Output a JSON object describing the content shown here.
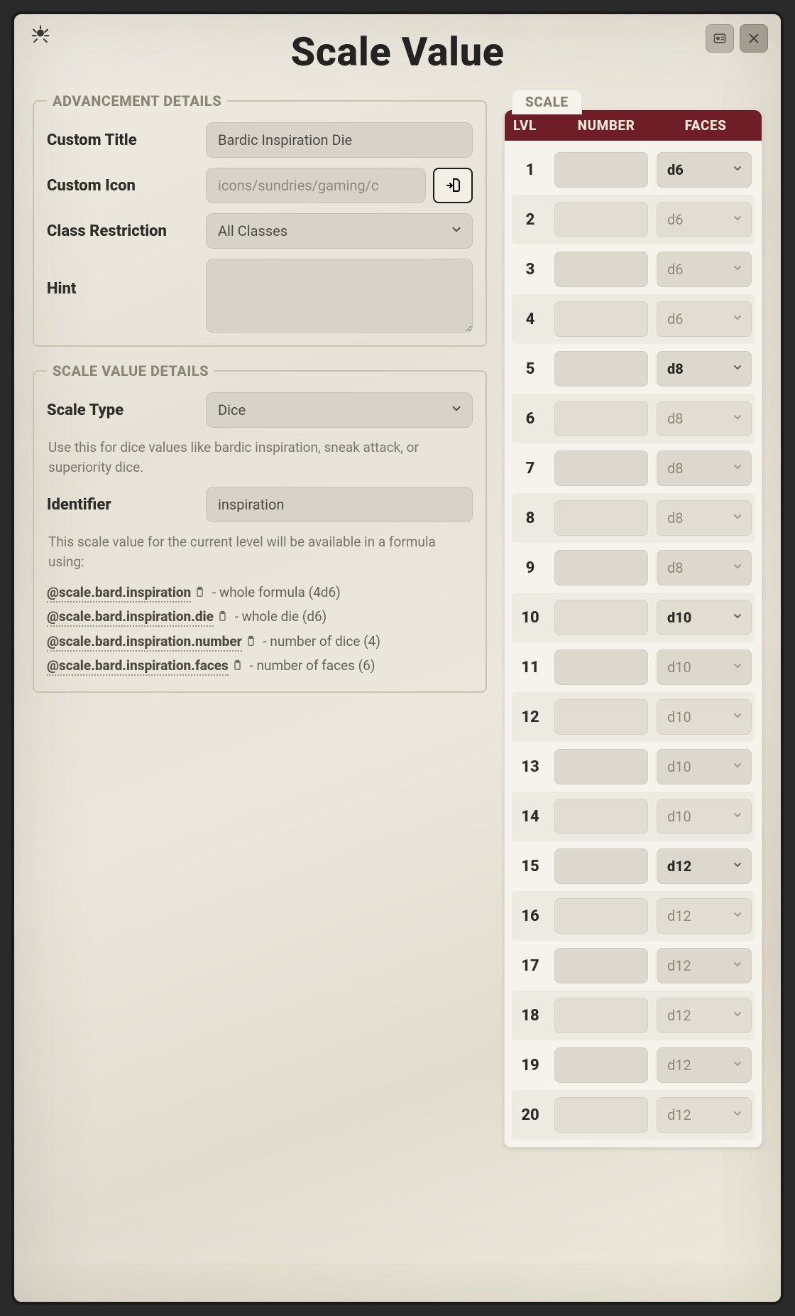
{
  "window": {
    "title": "Scale Value"
  },
  "advancement": {
    "legend": "ADVANCEMENT DETAILS",
    "title_label": "Custom Title",
    "title_value": "Bardic Inspiration Die",
    "icon_label": "Custom Icon",
    "icon_placeholder": "icons/sundries/gaming/c",
    "restriction_label": "Class Restriction",
    "restriction_value": "All Classes",
    "hint_label": "Hint",
    "hint_value": ""
  },
  "scale_details": {
    "legend": "SCALE VALUE DETAILS",
    "type_label": "Scale Type",
    "type_value": "Dice",
    "type_hint": "Use this for dice values like bardic inspiration, sneak attack, or superiority dice.",
    "identifier_label": "Identifier",
    "identifier_value": "inspiration",
    "id_hint_intro": "This scale value for the current level will be available in a formula using:",
    "formulas": [
      {
        "key": "@scale.bard.inspiration",
        "desc": " - whole formula (4d6)"
      },
      {
        "key": "@scale.bard.inspiration.die",
        "desc": " - whole die (d6)"
      },
      {
        "key": "@scale.bard.inspiration.number",
        "desc": " - number of dice (4)"
      },
      {
        "key": "@scale.bard.inspiration.faces",
        "desc": " - number of faces (6)"
      }
    ]
  },
  "scale_table": {
    "tab": "SCALE",
    "col_lvl": "LVL",
    "col_number": "NUMBER",
    "col_faces": "FACES",
    "rows": [
      {
        "level": 1,
        "number": "",
        "faces": "d6",
        "explicit": true
      },
      {
        "level": 2,
        "number": "",
        "faces": "d6",
        "explicit": false
      },
      {
        "level": 3,
        "number": "",
        "faces": "d6",
        "explicit": false
      },
      {
        "level": 4,
        "number": "",
        "faces": "d6",
        "explicit": false
      },
      {
        "level": 5,
        "number": "",
        "faces": "d8",
        "explicit": true
      },
      {
        "level": 6,
        "number": "",
        "faces": "d8",
        "explicit": false
      },
      {
        "level": 7,
        "number": "",
        "faces": "d8",
        "explicit": false
      },
      {
        "level": 8,
        "number": "",
        "faces": "d8",
        "explicit": false
      },
      {
        "level": 9,
        "number": "",
        "faces": "d8",
        "explicit": false
      },
      {
        "level": 10,
        "number": "",
        "faces": "d10",
        "explicit": true
      },
      {
        "level": 11,
        "number": "",
        "faces": "d10",
        "explicit": false
      },
      {
        "level": 12,
        "number": "",
        "faces": "d10",
        "explicit": false
      },
      {
        "level": 13,
        "number": "",
        "faces": "d10",
        "explicit": false
      },
      {
        "level": 14,
        "number": "",
        "faces": "d10",
        "explicit": false
      },
      {
        "level": 15,
        "number": "",
        "faces": "d12",
        "explicit": true
      },
      {
        "level": 16,
        "number": "",
        "faces": "d12",
        "explicit": false
      },
      {
        "level": 17,
        "number": "",
        "faces": "d12",
        "explicit": false
      },
      {
        "level": 18,
        "number": "",
        "faces": "d12",
        "explicit": false
      },
      {
        "level": 19,
        "number": "",
        "faces": "d12",
        "explicit": false
      },
      {
        "level": 20,
        "number": "",
        "faces": "d12",
        "explicit": false
      }
    ]
  }
}
